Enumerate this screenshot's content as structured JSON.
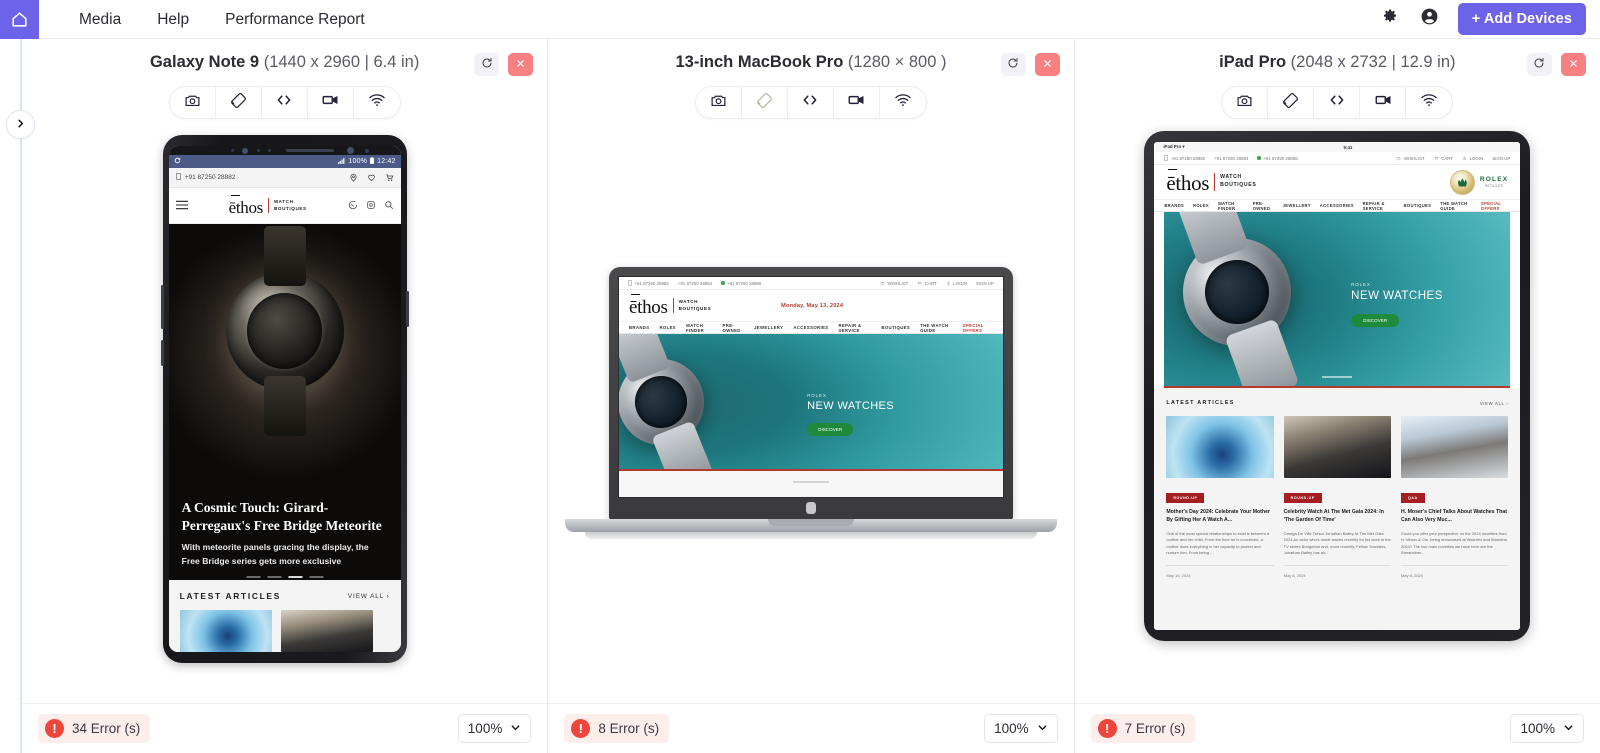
{
  "topbar": {
    "home_icon": "home-icon",
    "menu": [
      {
        "label": "Media"
      },
      {
        "label": "Help"
      },
      {
        "label": "Performance Report"
      }
    ],
    "settings_icon": "gear-icon",
    "account_icon": "account-circle-icon",
    "add_devices_label": "+ Add Devices"
  },
  "sidebar": {
    "toggle_icon": "chevron-right-icon"
  },
  "panels": [
    {
      "device_name": "Galaxy Note 9",
      "device_spec": "(1440 x 2960 | 6.4 in)",
      "reload_icon": "reload-icon",
      "close_icon": "close-icon",
      "tools": [
        {
          "name": "screenshot-icon",
          "label": "camera",
          "disabled": false
        },
        {
          "name": "rotate-icon",
          "label": "screen-rotation",
          "disabled": false
        },
        {
          "name": "devtools-icon",
          "label": "code",
          "disabled": false
        },
        {
          "name": "record-icon",
          "label": "video",
          "disabled": false
        },
        {
          "name": "network-icon",
          "label": "wifi",
          "disabled": false
        }
      ],
      "error_count": "34 Error (s)",
      "zoom_level": "100%"
    },
    {
      "device_name": "13-inch MacBook Pro",
      "device_spec": "(1280 × 800 )",
      "reload_icon": "reload-icon",
      "close_icon": "close-icon",
      "tools": [
        {
          "name": "screenshot-icon",
          "label": "camera",
          "disabled": false
        },
        {
          "name": "rotate-icon",
          "label": "screen-rotation",
          "disabled": true
        },
        {
          "name": "devtools-icon",
          "label": "code",
          "disabled": false
        },
        {
          "name": "record-icon",
          "label": "video",
          "disabled": false
        },
        {
          "name": "network-icon",
          "label": "wifi",
          "disabled": false
        }
      ],
      "error_count": "8 Error (s)",
      "zoom_level": "100%"
    },
    {
      "device_name": "iPad Pro",
      "device_spec": "(2048 x 2732 | 12.9 in)",
      "reload_icon": "reload-icon",
      "close_icon": "close-icon",
      "tools": [
        {
          "name": "screenshot-icon",
          "label": "camera",
          "disabled": false
        },
        {
          "name": "rotate-icon",
          "label": "screen-rotation",
          "disabled": false
        },
        {
          "name": "devtools-icon",
          "label": "code",
          "disabled": false
        },
        {
          "name": "record-icon",
          "label": "video",
          "disabled": false
        },
        {
          "name": "network-icon",
          "label": "wifi",
          "disabled": false
        }
      ],
      "error_count": "7 Error (s)",
      "zoom_level": "100%"
    }
  ],
  "phone_page": {
    "status_battery": "100%",
    "status_time": "12:42",
    "phone_number": "+91 87250 28882",
    "brand": "ēthos",
    "brand_line1": "WATCH",
    "brand_line2": "BOUTIQUES",
    "hero_title": "A Cosmic Touch: Girard-Perregaux's Free Bridge Meteorite",
    "hero_sub": "With meteorite panels gracing the display, the Free Bridge series gets more exclusive",
    "latest_title": "LATEST ARTICLES",
    "view_all": "VIEW ALL ›"
  },
  "laptop_page": {
    "util_left": [
      "+91 87250 28882",
      "+91 87250 28884",
      "+91 87250 28886"
    ],
    "util_right": [
      "WISHLIST",
      "CART",
      "LOGIN",
      "SIGN UP"
    ],
    "brand": "ēthos",
    "brand_line1": "WATCH",
    "brand_line2": "BOUTIQUES",
    "dateline": "Monday, May 13, 2024",
    "nav": [
      "BRANDS",
      "ROLEX",
      "WATCH FINDER",
      "PRE-OWNED",
      "JEWELLERY",
      "ACCESSORIES",
      "REPAIR & SERVICE",
      "BOUTIQUES",
      "THE WATCH GUIDE",
      "SPECIAL OFFERS"
    ],
    "hero_kicker": "ROLEX",
    "hero_title": "NEW WATCHES",
    "hero_button": "DISCOVER"
  },
  "tablet_page": {
    "ios_device": "iPad Pro",
    "ios_time": "9:41",
    "util_left": [
      "+91 87250 28882",
      "+91 87250 28884",
      "+91 87250 28886"
    ],
    "util_right": [
      "WISHLIST",
      "CART",
      "LOGIN",
      "SIGN UP"
    ],
    "brand": "ēthos",
    "brand_line1": "WATCH",
    "brand_line2": "BOUTIQUES",
    "rolex_word": "ROLEX",
    "rolex_sub": "RETAILER",
    "nav": [
      "BRANDS",
      "ROLEX",
      "WATCH FINDER",
      "PRE-OWNED",
      "JEWELLERY",
      "ACCESSORIES",
      "REPAIR & SERVICE",
      "BOUTIQUES",
      "THE WATCH GUIDE",
      "SPECIAL OFFERS"
    ],
    "hero_kicker": "ROLEX",
    "hero_title": "NEW WATCHES",
    "hero_button": "DISCOVER",
    "latest_title": "LATEST ARTICLES",
    "view_all": "VIEW ALL ›",
    "articles": [
      {
        "badge": "ROUND-UP",
        "title": "Mother's Day 2024: Celebrate Your Mother By Gifting Her A Watch A...",
        "excerpt": "One of the most special relationships to exist is between a mother and her child. From the time he is conceived, a mother does everything in her capacity to protect and nurture him. From being ...",
        "date": "May 10, 2024"
      },
      {
        "badge": "ROUND-UP",
        "title": "Celebrity Watch At The Met Gala 2024: In 'The Garden Of Time'",
        "excerpt": "Omega De Ville Trésor Jonathan Bailey At The Met Gala 2024 An actor who's made waves recently for his work in the TV series Bridgerton and, more recently, Fellow Travelers, Jonathan Bailey has alr...",
        "date": "May 8, 2024"
      },
      {
        "badge": "Q&A",
        "title": "H. Moser's Chief Talks About Watches That Can Also Very Muc...",
        "excerpt": "Could you offer your perspective on the 2024 novelties from H. Moser & Cie. being showcased at Watches and Wonders 2024? The two main novelties we have here are the Streamliner...",
        "date": "May 8, 2024"
      }
    ]
  }
}
